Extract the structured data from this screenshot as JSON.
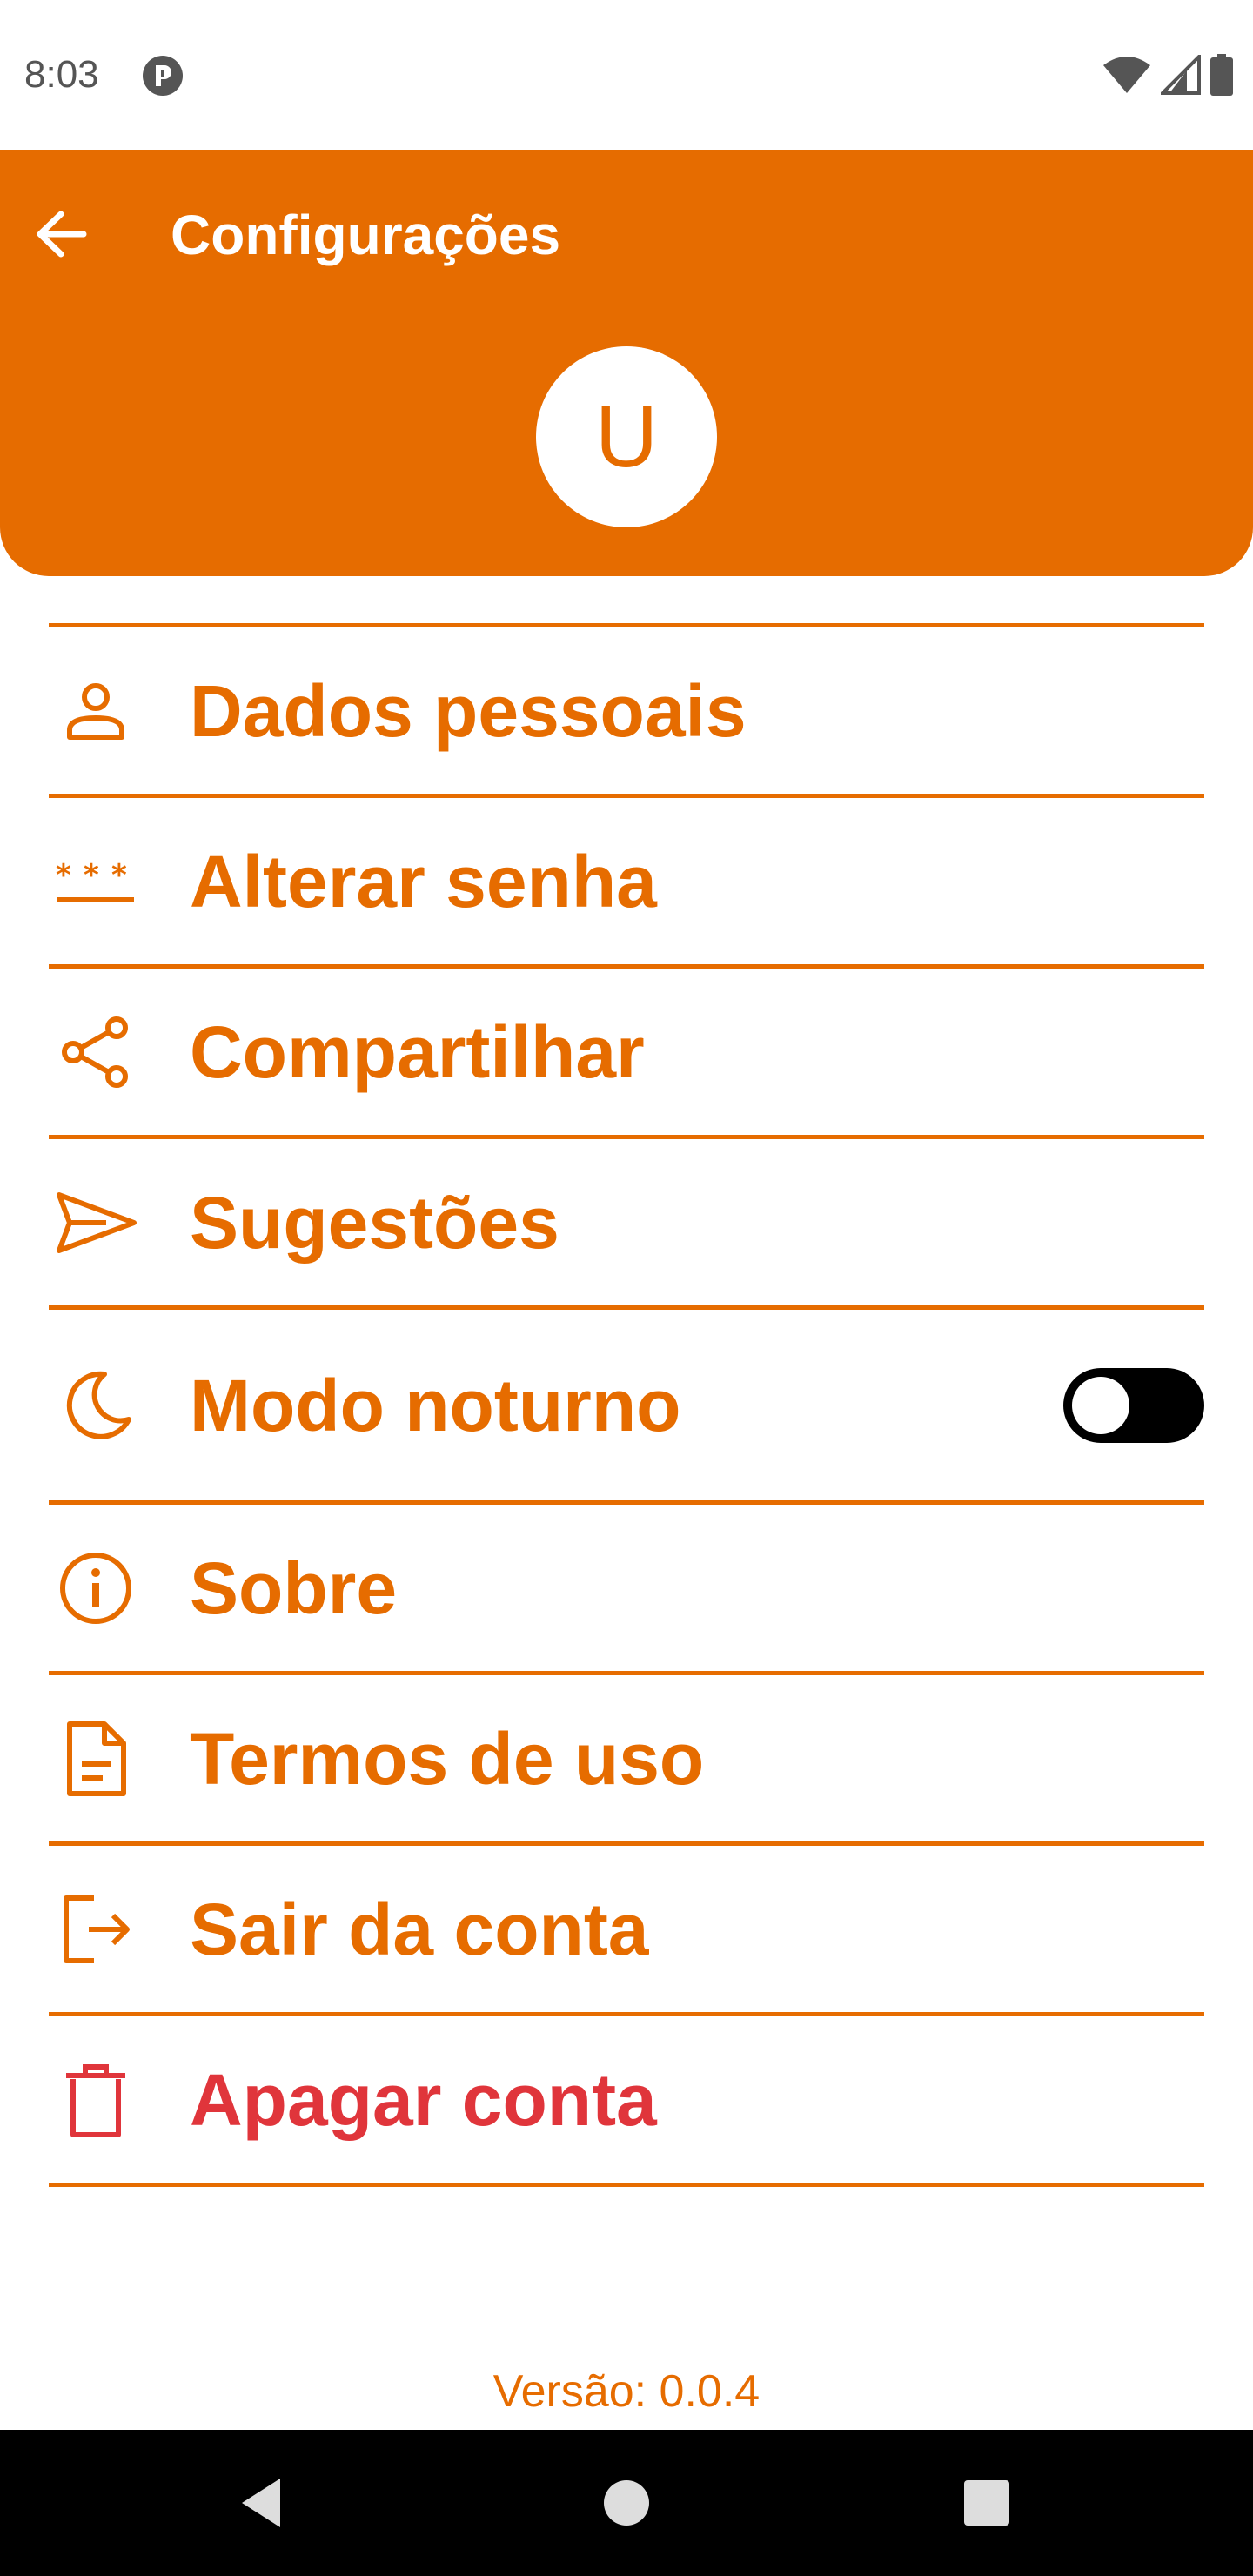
{
  "status_bar": {
    "time": "8:03",
    "app_icon": "pocket-casts-like-icon",
    "icons": [
      "wifi-icon",
      "cell-signal-icon",
      "battery-icon"
    ]
  },
  "header": {
    "back_icon": "arrow-back-icon",
    "title": "Configurações",
    "avatar_initial": "U",
    "background_color": "#E66C00"
  },
  "menu": {
    "accent_color": "#E66C00",
    "danger_color": "#E0353B",
    "items": [
      {
        "label": "Dados pessoais",
        "icon": "person-icon"
      },
      {
        "label": "Alterar senha",
        "icon": "password-icon"
      },
      {
        "label": "Compartilhar",
        "icon": "share-icon"
      },
      {
        "label": "Sugestões",
        "icon": "send-icon"
      },
      {
        "label": "Modo noturno",
        "icon": "moon-icon",
        "toggle_on": false
      },
      {
        "label": "Sobre",
        "icon": "info-icon"
      },
      {
        "label": "Termos de uso",
        "icon": "document-icon"
      },
      {
        "label": "Sair da conta",
        "icon": "logout-icon"
      },
      {
        "label": "Apagar conta",
        "icon": "trash-icon"
      }
    ]
  },
  "footer": {
    "version": "Versão: 0.0.4"
  },
  "nav_bar": {
    "buttons": [
      "back-triangle-icon",
      "home-circle-icon",
      "recents-square-icon"
    ]
  }
}
